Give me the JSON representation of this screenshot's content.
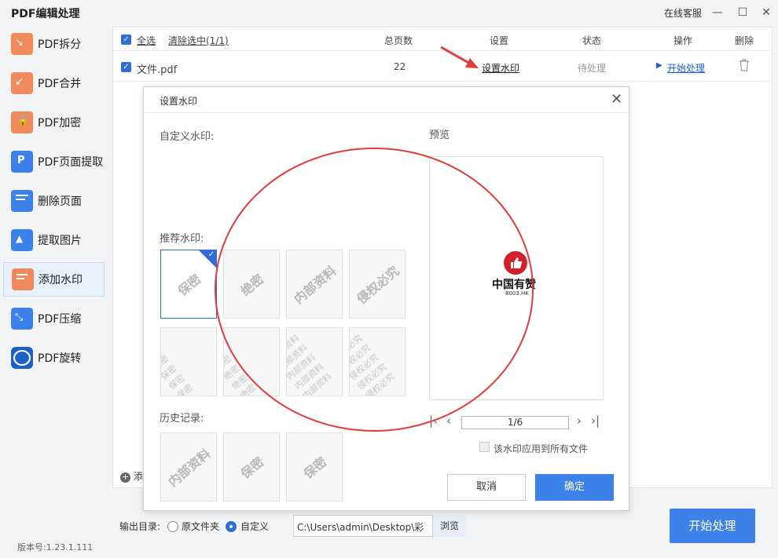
{
  "app": {
    "title": "PDF编辑处理",
    "online_service": "在线客服",
    "window_controls": {
      "minimize": "—",
      "maximize": "☐",
      "close": "✕"
    }
  },
  "sidebar": {
    "items": [
      {
        "label": "PDF拆分",
        "icon": "split-icon",
        "color": "#f08a5d"
      },
      {
        "label": "PDF合并",
        "icon": "merge-icon",
        "color": "#f08a5d"
      },
      {
        "label": "PDF加密",
        "icon": "lock-icon",
        "color": "#f08a5d"
      },
      {
        "label": "PDF页面提取",
        "icon": "page-extract-icon",
        "color": "#3d82e8"
      },
      {
        "label": "删除页面",
        "icon": "delete-page-icon",
        "color": "#3d82e8"
      },
      {
        "label": "提取图片",
        "icon": "extract-image-icon",
        "color": "#3d82e8"
      },
      {
        "label": "添加水印",
        "icon": "watermark-icon",
        "color": "#f08a5d"
      },
      {
        "label": "PDF压缩",
        "icon": "compress-icon",
        "color": "#3d82e8"
      },
      {
        "label": "PDF旋转",
        "icon": "rotate-icon",
        "color": "#3d82e8"
      }
    ],
    "active_index": 6
  },
  "table": {
    "select_all": "全选",
    "clear_selection": "清除选中(1/1)",
    "headers": {
      "pages": "总页数",
      "settings": "设置",
      "status": "状态",
      "action": "操作",
      "delete": "删除"
    },
    "rows": [
      {
        "file": "文件.pdf",
        "pages": "22",
        "settings": "设置水印",
        "status": "待处理",
        "action": "开始处理"
      }
    ],
    "add_partial": "添"
  },
  "output": {
    "label": "输出目录:",
    "option_original": "原文件夹",
    "option_custom": "自定义",
    "path": "C:\\Users\\admin\\Desktop\\彩",
    "browse": "浏览"
  },
  "start_button": "开始处理",
  "version": "版本号:1.23.1.111",
  "dialog": {
    "title": "设置水印",
    "custom_label": "自定义水印:",
    "recommended_label": "推荐水印:",
    "history_label": "历史记录:",
    "preview_label": "预览",
    "recommended": [
      "保密",
      "绝密",
      "内部资料",
      "侵权必究"
    ],
    "recommended_patterns": [
      "保密",
      "绝密",
      "内部资料",
      "侵权必究"
    ],
    "history": [
      "内部资料",
      "保密",
      "保密"
    ],
    "preview_logo_text": "中国有赞",
    "preview_logo_sub": "8003.HK",
    "page_indicator": "1/6",
    "apply_all": "该水印应用到所有文件",
    "cancel": "取消",
    "ok": "确定"
  },
  "colors": {
    "accent": "#3d82e8",
    "annotation_red": "#e33b3b",
    "logo_red": "#d3202a"
  }
}
